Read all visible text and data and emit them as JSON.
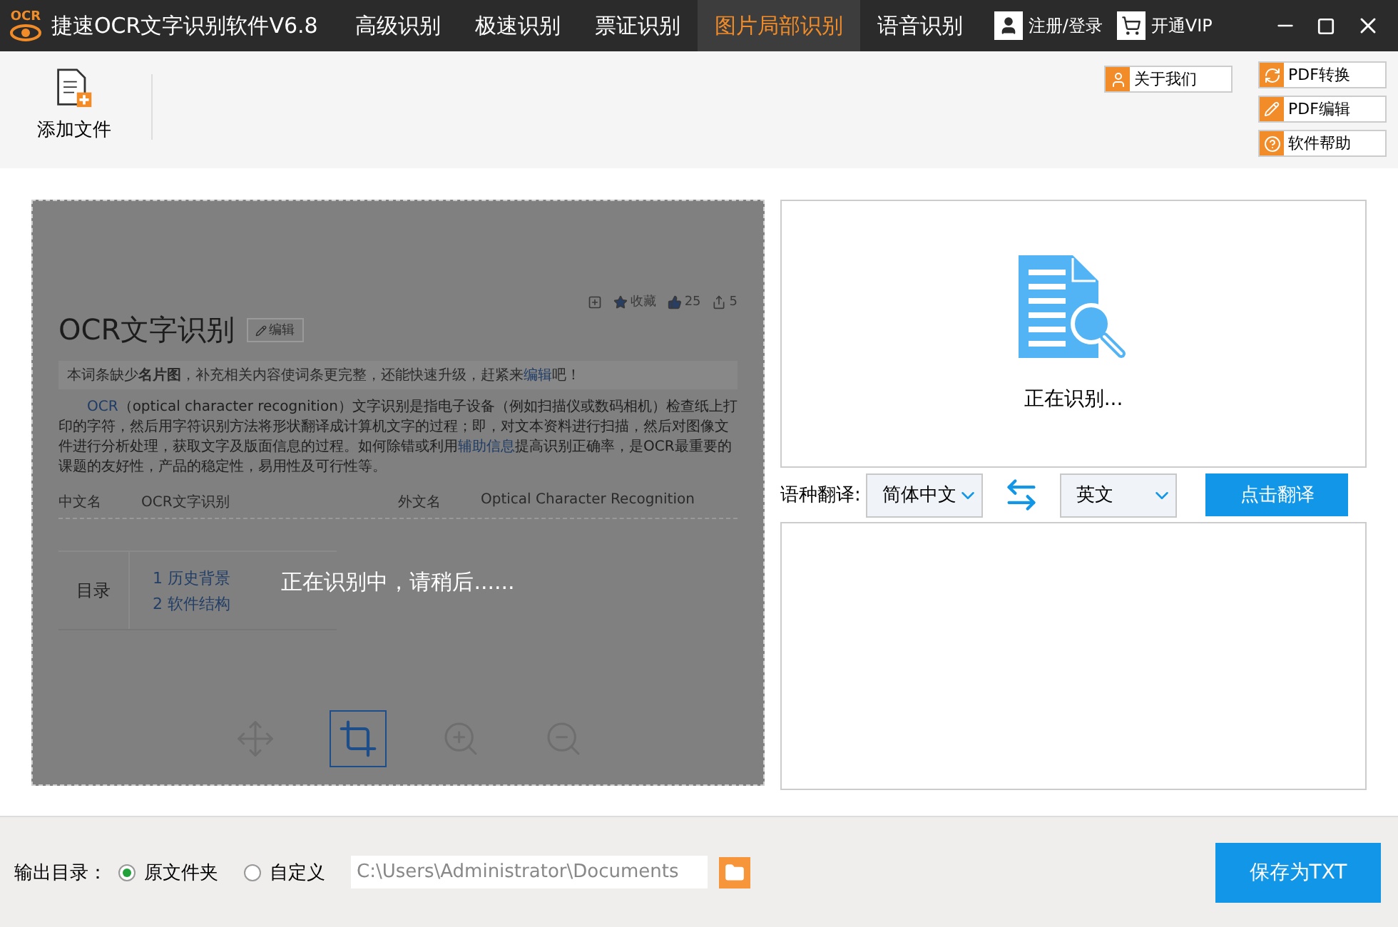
{
  "app": {
    "logo": "OCR",
    "title": "捷速OCR文字识别软件V6.8"
  },
  "nav_tabs": [
    {
      "label": "高级识别",
      "selected": false
    },
    {
      "label": "极速识别",
      "selected": false
    },
    {
      "label": "票证识别",
      "selected": false
    },
    {
      "label": "图片局部识别",
      "selected": true
    },
    {
      "label": "语音识别",
      "selected": false
    }
  ],
  "account": [
    {
      "label": "注册/登录",
      "kind": "user"
    },
    {
      "label": "开通VIP",
      "kind": "cart"
    }
  ],
  "toolbar": {
    "add_file": "添加文件",
    "about": "关于我们",
    "side_buttons": [
      {
        "label": "PDF转换",
        "kind": "convert"
      },
      {
        "label": "PDF编辑",
        "kind": "edit"
      },
      {
        "label": "软件帮助",
        "kind": "help"
      }
    ]
  },
  "preview": {
    "document": {
      "actions": [
        {
          "kind": "add"
        },
        {
          "kind": "star",
          "label": "收藏"
        },
        {
          "kind": "like",
          "label": "25"
        },
        {
          "kind": "share",
          "label": "5"
        }
      ],
      "title": "OCR文字识别",
      "edit_button": "编辑",
      "notice": [
        {
          "text": "本词条缺少",
          "link": false
        },
        {
          "text": "**名片图**，补充相关内容使词条更完整，还能快速升级，赶紧来",
          "link": false
        },
        {
          "text": "编辑",
          "link": true
        },
        {
          "text": "吧！",
          "link": false
        }
      ],
      "paragraph": [
        {
          "text": "OCR",
          "link": true
        },
        {
          "text": "（optical character recognition）文字识别是指电子设备（例如扫描仪或数码相机）检查纸上打印的字符，然后用字符识别方法将形状翻译成计算机文字的过程；即，对文本资料进行扫描，然后对图像文件进行分析处理，获取文字及版面信息的过程。如何除错或利用",
          "link": false
        },
        {
          "text": "辅助信息",
          "link": true
        },
        {
          "text": "提高识别正确率，是OCR最重要的课题的友好性，产品的稳定性，易用性及可行性等。",
          "link": false
        }
      ],
      "info": [
        {
          "label": "中文名",
          "value": "OCR文字识别"
        },
        {
          "label": "外文名",
          "value": "Optical Character Recognition"
        }
      ],
      "toc": {
        "label": "目录",
        "items": [
          {
            "number": "1",
            "text": "历史背景"
          },
          {
            "number": "2",
            "text": "软件结构"
          }
        ]
      }
    },
    "status": "正在识别中，请稍后......",
    "tools": [
      {
        "kind": "move",
        "selected": false
      },
      {
        "kind": "crop",
        "selected": true
      },
      {
        "kind": "zoom_in",
        "selected": false
      },
      {
        "kind": "zoom_out",
        "selected": false
      }
    ]
  },
  "result": {
    "status": "正在识别..."
  },
  "translate": {
    "label": "语种翻译:",
    "source": "简体中文",
    "target": "英文",
    "button": "点击翻译"
  },
  "output": {
    "label": "输出目录：",
    "options": [
      {
        "label": "原文件夹",
        "selected": true
      },
      {
        "label": "自定义",
        "selected": false
      }
    ],
    "path": "C:\\Users\\Administrator\\Documents",
    "save_button": "保存为TXT"
  }
}
